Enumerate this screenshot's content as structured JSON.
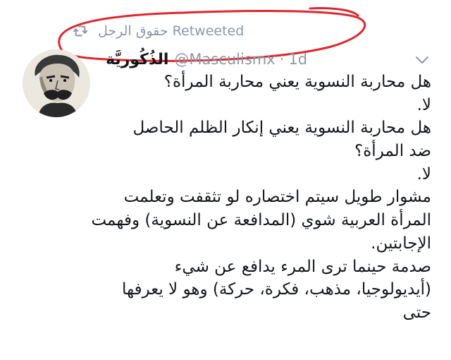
{
  "retweet": {
    "icon": "retweet-icon",
    "text": "حقوق الرجل Retweeted"
  },
  "tweet": {
    "author": {
      "display_name": "الذُكُوريَّة",
      "handle": "@Masculismx",
      "separator": "·",
      "time": "1d",
      "avatar": "avatar-portrait"
    },
    "menu_icon": "chevron-down-icon",
    "lines": [
      "هل محاربة النسوية يعني محاربة المرأة؟",
      "لا.",
      "هل محاربة النسوية يعني إنكار الظلم الحاصل",
      "ضد المرأة؟",
      "لا.",
      "مشوار طويل سيتم اختصاره لو تثقفت وتعلمت",
      "المرأة العربية شوي (المدافعة عن النسوية) وفهمت",
      "الإجابتين.",
      "صدمة حينما ترى المرء يدافع عن شيء",
      "(أيديولوجيا، مذهب، فكرة، حركة) وهو لا يعرفها",
      "حتى"
    ]
  },
  "colors": {
    "secondary_text": "#8c98a4",
    "primary_text": "#14171a",
    "highlight": "#e0262d"
  }
}
